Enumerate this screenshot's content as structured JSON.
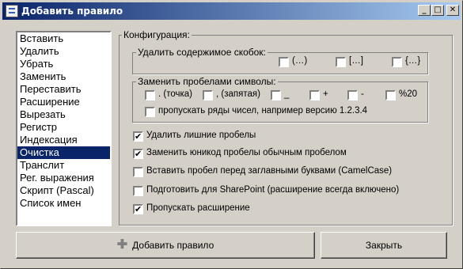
{
  "window": {
    "title": "Добавить правило"
  },
  "titlebar": {
    "minimize_glyph": "_",
    "maximize_glyph": "□",
    "close_glyph": "✕"
  },
  "sidebar": {
    "items": [
      {
        "label": "Вставить"
      },
      {
        "label": "Удалить"
      },
      {
        "label": "Убрать"
      },
      {
        "label": "Заменить"
      },
      {
        "label": "Переставить"
      },
      {
        "label": "Расширение"
      },
      {
        "label": "Вырезать"
      },
      {
        "label": "Регистр"
      },
      {
        "label": "Индексация"
      },
      {
        "label": "Очистка",
        "selected": true
      },
      {
        "label": "Транслит"
      },
      {
        "label": "Рег. выражения"
      },
      {
        "label": "Скрипт (Pascal)"
      },
      {
        "label": "Список имен"
      }
    ]
  },
  "config": {
    "title": "Конфигурация:",
    "brackets": {
      "title": "Удалить содержимое скобок:",
      "options": [
        {
          "label": "(…)",
          "checked": false
        },
        {
          "label": "[…]",
          "checked": false
        },
        {
          "label": "{…}",
          "checked": false
        }
      ]
    },
    "spaces": {
      "title": "Заменить пробелами символы:",
      "options": [
        {
          "label": ". (точка)",
          "checked": false
        },
        {
          "label": ", (запятая)",
          "checked": false
        },
        {
          "label": "_",
          "checked": false
        },
        {
          "label": "+",
          "checked": false
        },
        {
          "label": "-",
          "checked": false
        },
        {
          "label": "%20",
          "checked": false
        }
      ],
      "skip_numbers": {
        "label": "пропускать ряды чисел, например версию 1.2.3.4",
        "checked": false
      }
    },
    "options": [
      {
        "label": "Удалить лишние пробелы",
        "checked": true
      },
      {
        "label": "Заменить юникод пробелы обычным пробелом",
        "checked": true
      },
      {
        "label": "Вставить пробел перед заглавными буквами (CamelCase)",
        "checked": false
      },
      {
        "label": "Подготовить для SharePoint (расширение всегда включено)",
        "checked": false
      },
      {
        "label": "Пропускать расширение",
        "checked": true
      }
    ]
  },
  "buttons": {
    "add_label": "Добавить правило",
    "close_label": "Закрыть"
  },
  "check_mark": "✔",
  "colors": {
    "title_start": "#0a246a",
    "title_end": "#a6caf0",
    "face": "#d4d0c8",
    "selection": "#0a246a"
  }
}
